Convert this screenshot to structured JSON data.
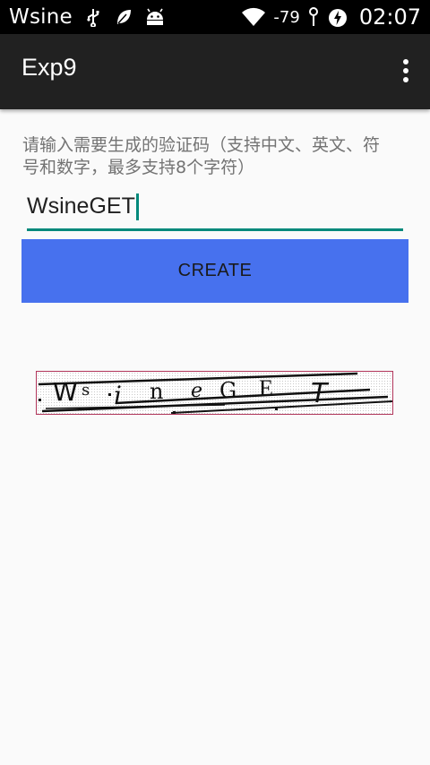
{
  "status_bar": {
    "title": "Wsine",
    "signal": "-79",
    "time": "02:07",
    "icons": [
      "usb-icon",
      "leaf-icon",
      "android-icon",
      "wifi-icon",
      "signal-icon",
      "data-saver-icon"
    ]
  },
  "app_bar": {
    "title": "Exp9",
    "overflow_icon": "more-vert-icon"
  },
  "prompt": "请输入需要生成的验证码（支持中文、英文、符号和数字，最多支持8个字符）",
  "input": {
    "value": "WsineGET"
  },
  "create_button": {
    "label": "CREATE"
  },
  "captcha": {
    "chars": [
      "W",
      "s",
      "i",
      "n",
      "e",
      "G",
      "E",
      "T"
    ]
  },
  "colors": {
    "accent": "#00897b",
    "button": "#4771ee",
    "app_bar": "#212121",
    "captcha_border": "#b0355a"
  }
}
